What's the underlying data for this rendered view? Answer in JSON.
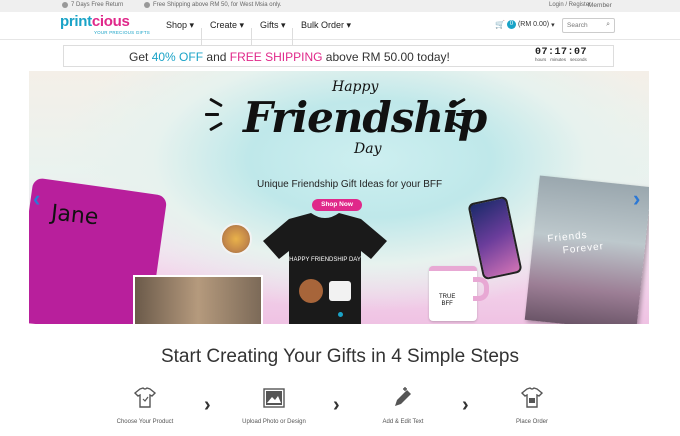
{
  "topbar": {
    "return": "7 Days Free Return",
    "shipping": "Free Shipping above RM 50, for West Msia only.",
    "login": "Login / Register",
    "member": "Member"
  },
  "brand": {
    "name_part1": "print",
    "name_part2": "cious",
    "tagline": "YOUR PRECIOUS GIFTS"
  },
  "nav": {
    "items": [
      {
        "label": "Shop"
      },
      {
        "label": "Create"
      },
      {
        "label": "Gifts"
      },
      {
        "label": "Bulk Order"
      }
    ],
    "cart_count": "0",
    "cart_total": "(RM 0.00)",
    "search_placeholder": "Search"
  },
  "promo": {
    "pre": "Get",
    "discount": "40% OFF",
    "mid": "and",
    "shipping": "FREE SHIPPING",
    "post": "above RM 50.00 today!",
    "timer": "07:17:07",
    "timer_labels": [
      "hours",
      "minutes",
      "seconds"
    ]
  },
  "hero": {
    "happy": "Happy",
    "friendship": "Friendship",
    "day": "Day",
    "subtitle": "Unique Friendship Gift Ideas for your BFF",
    "cta": "Shop Now",
    "pillow_name": "Jane",
    "tshirt_text": "HAPPY FRIENDSHIP DAY",
    "mug_text_1": "TRUE",
    "mug_text_2": "BFF",
    "canvas_text_1": "Friends",
    "canvas_text_2": "Forever",
    "accent_color": "#e0288a",
    "brand_color": "#1aa3c7"
  },
  "steps": {
    "title": "Start Creating Your Gifts in 4 Simple Steps",
    "items": [
      {
        "label": "Choose Your Product",
        "icon": "tshirt-icon"
      },
      {
        "label": "Upload Photo or Design",
        "icon": "image-icon"
      },
      {
        "label": "Add & Edit Text",
        "icon": "pencil-icon"
      },
      {
        "label": "Place Order",
        "icon": "tshirt-check-icon"
      }
    ]
  }
}
